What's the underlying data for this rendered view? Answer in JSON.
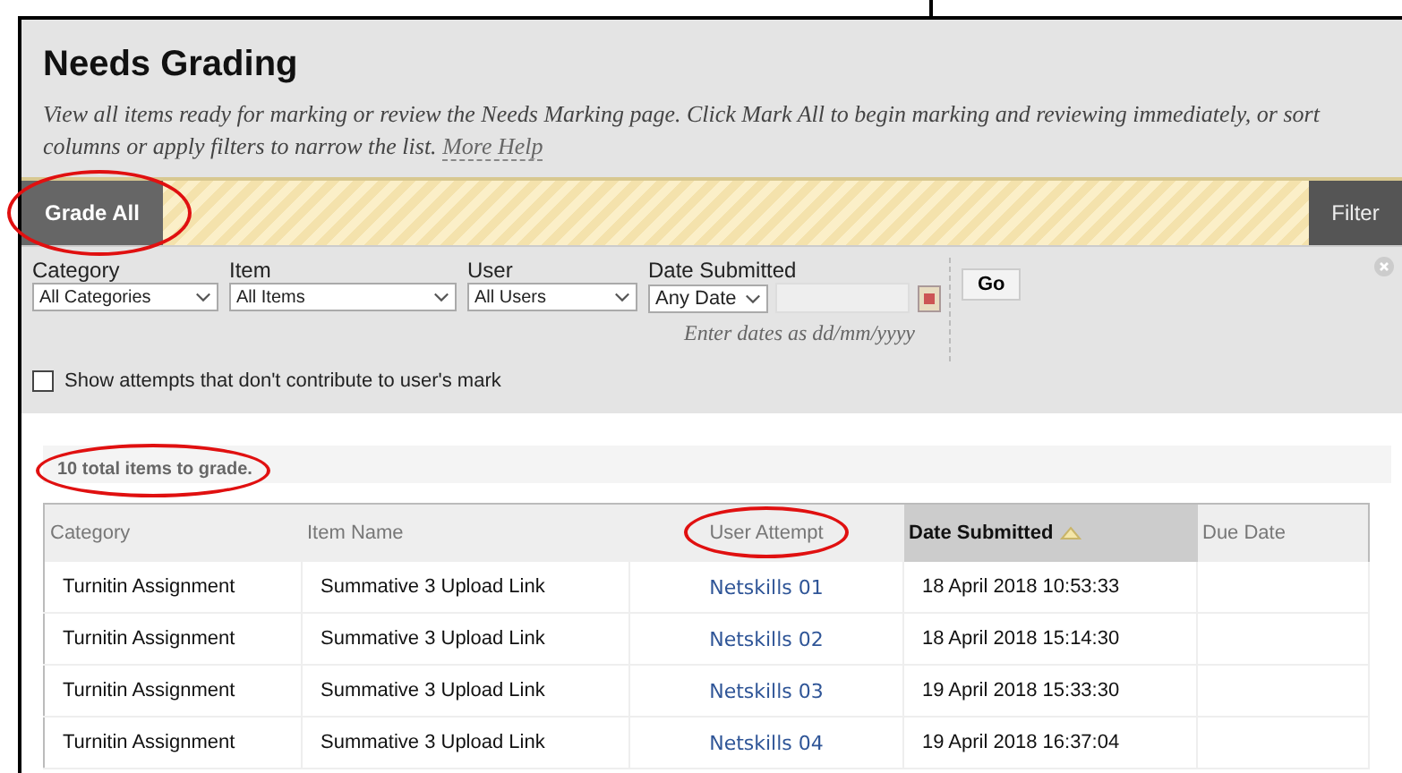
{
  "title": "Needs Grading",
  "description": "View all items ready for marking or review the Needs Marking page. Click Mark All to begin marking and reviewing immediately, or sort columns or apply filters to narrow the list.",
  "help_link": "More Help",
  "grade_all_button": {
    "label": "Grade All",
    "circled": true
  },
  "filter_button": {
    "label": "Filter"
  },
  "filters": [
    {
      "label": "Category",
      "value": "All Categories"
    },
    {
      "label": "Item",
      "value": "All Items"
    },
    {
      "label": "User",
      "value": "All Users"
    }
  ],
  "date_filter": {
    "label": "Date Submitted",
    "value": "Any Date",
    "hint": "Enter dates as dd/mm/yyyy"
  },
  "go_button": "Go",
  "show_attempts": {
    "label": "Show attempts that don't contribute to user's mark",
    "checked": false
  },
  "total": {
    "text": "10 total items to grade.",
    "circled": true
  },
  "table": {
    "columns": [
      {
        "label": "Category",
        "sorted": false,
        "circled": false
      },
      {
        "label": "Item Name",
        "sorted": false,
        "circled": false
      },
      {
        "label": "User Attempt",
        "sorted": false,
        "circled": true
      },
      {
        "label": "Date Submitted",
        "sorted": true,
        "circled": false
      },
      {
        "label": "Due Date",
        "sorted": false,
        "circled": false
      }
    ],
    "rows": [
      [
        "Turnitin Assignment",
        "Summative 3 Upload Link",
        "Netskills 01",
        "18 April 2018 10:53:33",
        ""
      ],
      [
        "Turnitin Assignment",
        "Summative 3 Upload Link",
        "Netskills 02",
        "18 April 2018 15:14:30",
        ""
      ],
      [
        "Turnitin Assignment",
        "Summative 3 Upload Link",
        "Netskills 03",
        "19 April 2018 15:33:30",
        ""
      ],
      [
        "Turnitin Assignment",
        "Summative 3 Upload Link",
        "Netskills 04",
        "19 April 2018 16:37:04",
        ""
      ]
    ]
  }
}
